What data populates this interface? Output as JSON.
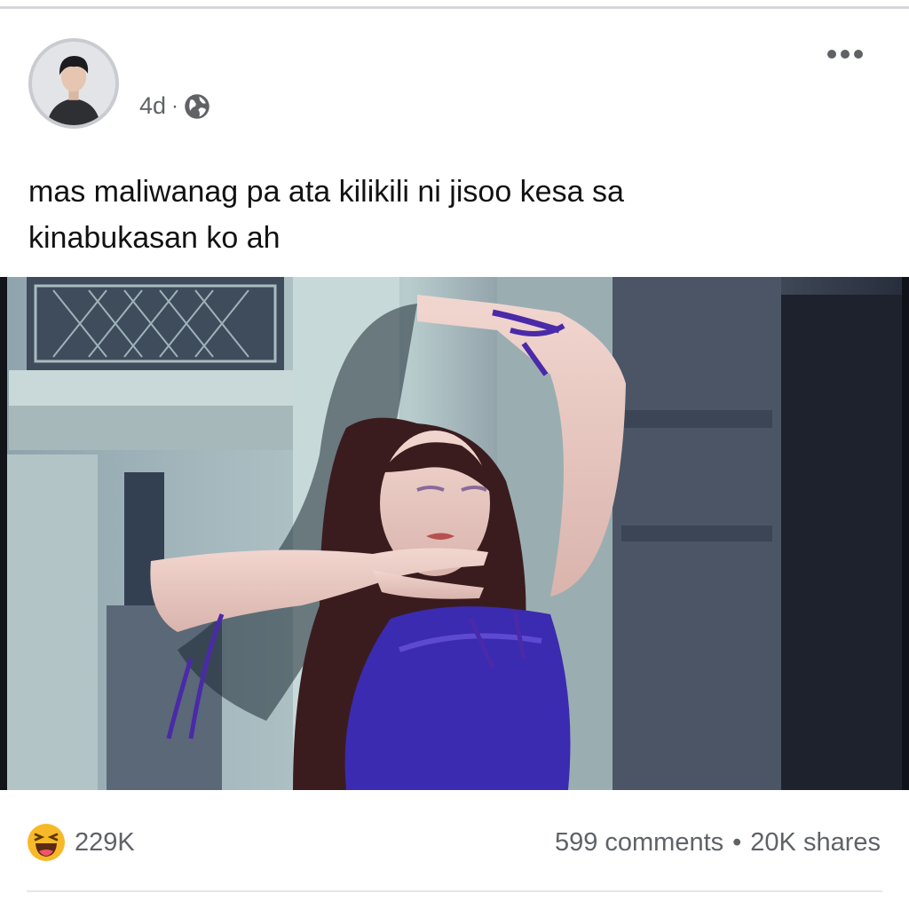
{
  "post": {
    "timestamp": "4d",
    "separator": "·",
    "privacy_icon": "globe-icon",
    "more_icon": "more-options-icon",
    "text_line1": "mas maliwanag pa ata kilikili ni jisoo kesa sa",
    "text_line2": "kinabukasan ko ah"
  },
  "reactions": {
    "icon": "haha-reaction-icon",
    "count": "229K"
  },
  "engagement": {
    "comments": "599 comments",
    "separator": "•",
    "shares": "20K shares"
  },
  "colors": {
    "secondary_text": "#5f6368",
    "primary_text": "#121212",
    "divider": "#d4d6dc",
    "accent_purple": "#4a2aa8"
  }
}
